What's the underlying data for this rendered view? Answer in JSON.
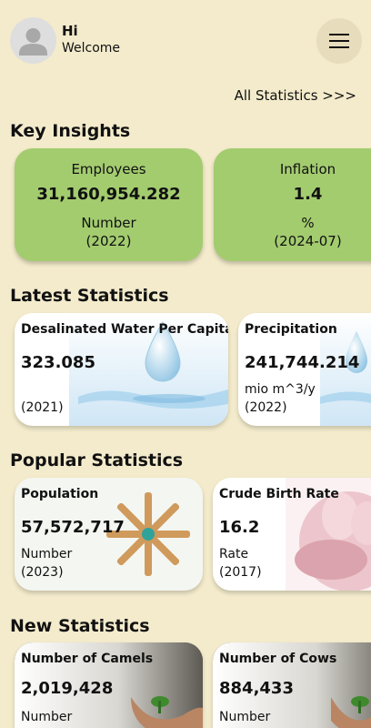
{
  "header": {
    "greeting": "Hi",
    "subtitle": "Welcome"
  },
  "all_statistics_link": "All Statistics >>>",
  "sections": {
    "key_insights": "Key Insights",
    "latest": "Latest Statistics",
    "popular": "Popular Statistics",
    "new": "New Statistics"
  },
  "key_insights": [
    {
      "title": "Employees",
      "value": "31,160,954.282",
      "unit": "Number",
      "period": "(2022)"
    },
    {
      "title": "Inflation",
      "value": "1.4",
      "unit": "%",
      "period": "(2024-07)"
    }
  ],
  "latest": [
    {
      "title": "Desalinated Water Per Capita",
      "value": "323.085",
      "unit": "",
      "period": "(2021)"
    },
    {
      "title": "Precipitation",
      "value": "241,744.214",
      "unit": "mio m^3/y",
      "period": "(2022)"
    }
  ],
  "popular": [
    {
      "title": "Population",
      "value": "57,572,717",
      "unit": "Number",
      "period": "(2023)"
    },
    {
      "title": "Crude Birth Rate",
      "value": "16.2",
      "unit": "Rate",
      "period": "(2017)"
    }
  ],
  "new": [
    {
      "title": "Number of Camels",
      "value": "2,019,428",
      "unit": "Number"
    },
    {
      "title": "Number of Cows",
      "value": "884,433",
      "unit": "Number"
    }
  ],
  "colors": {
    "background": "#f3ebcb",
    "key_card": "#a3cc6f",
    "menu_button": "#e7dcbb"
  },
  "icons": [
    "user-avatar-icon",
    "hamburger-menu-icon"
  ]
}
